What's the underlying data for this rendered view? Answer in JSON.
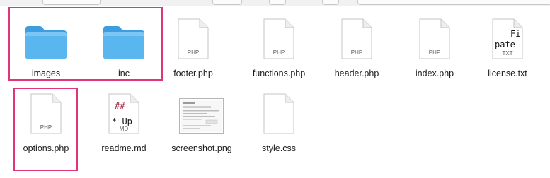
{
  "files": [
    {
      "name": "images",
      "kind": "folder"
    },
    {
      "name": "inc",
      "kind": "folder"
    },
    {
      "name": "footer.php",
      "kind": "doc",
      "ext": "PHP"
    },
    {
      "name": "functions.php",
      "kind": "doc",
      "ext": "PHP"
    },
    {
      "name": "header.php",
      "kind": "doc",
      "ext": "PHP"
    },
    {
      "name": "index.php",
      "kind": "doc",
      "ext": "PHP"
    },
    {
      "name": "license.txt",
      "kind": "text-preview",
      "ext": "TXT",
      "preview": [
        "Fi",
        "pate"
      ]
    },
    {
      "name": "options.php",
      "kind": "doc",
      "ext": "PHP"
    },
    {
      "name": "readme.md",
      "kind": "text-preview",
      "ext": "MD",
      "preview": [
        "##",
        "* Up"
      ]
    },
    {
      "name": "screenshot.png",
      "kind": "image-thumbnail"
    },
    {
      "name": "style.css",
      "kind": "doc",
      "ext": ""
    }
  ],
  "highlight_color": "#e0357a",
  "folder_color": "#56b4ee"
}
